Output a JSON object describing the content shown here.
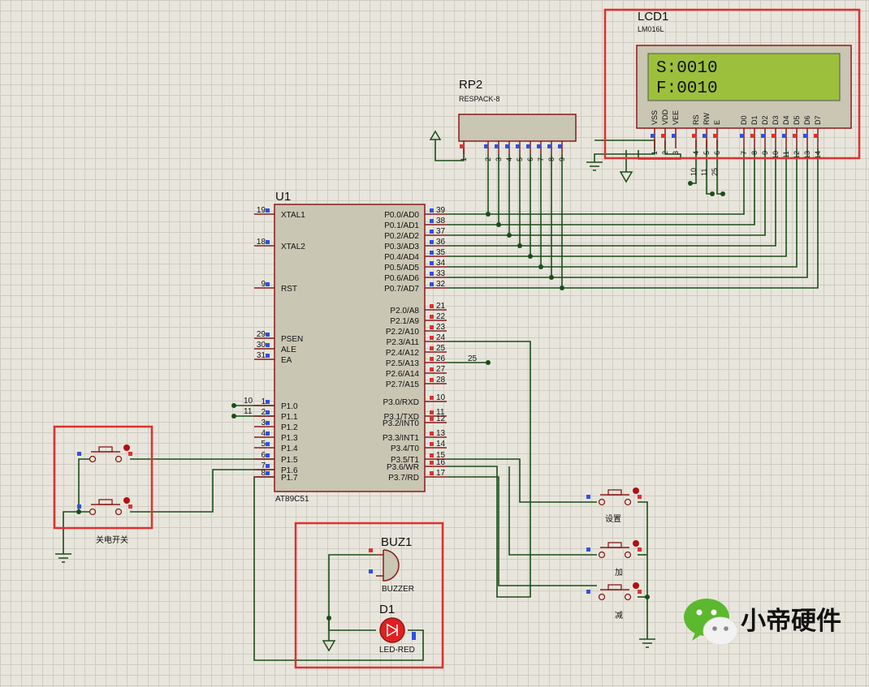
{
  "colors": {
    "background": "#e8e6dc",
    "grid": "#cfcdc2",
    "wire": "#1a4d1a",
    "component_border": "#8b1a1a",
    "component_fill": "#c9c6b4",
    "highlight": "#e03030",
    "lcd_screen": "#9cc03c",
    "led": "#e02020"
  },
  "lcd": {
    "ref": "LCD1",
    "part": "LM016L",
    "line1": "S:0010",
    "line2": "F:0010",
    "pin_names": [
      "VSS",
      "VDD",
      "VEE",
      "RS",
      "RW",
      "E",
      "D0",
      "D1",
      "D2",
      "D3",
      "D4",
      "D5",
      "D6",
      "D7"
    ],
    "pin_numbers": [
      "1",
      "2",
      "3",
      "4",
      "5",
      "6",
      "7",
      "8",
      "9",
      "10",
      "11",
      "12",
      "13",
      "14"
    ]
  },
  "rp2": {
    "ref": "RP2",
    "part": "RESPACK-8",
    "pin_numbers": [
      "1",
      "2",
      "3",
      "4",
      "5",
      "6",
      "7",
      "8",
      "9"
    ]
  },
  "mcu": {
    "ref": "U1",
    "part": "AT89C51",
    "left_pins": [
      {
        "num": "19",
        "name": "XTAL1"
      },
      {
        "num": "18",
        "name": "XTAL2"
      },
      {
        "num": "9",
        "name": "RST"
      },
      {
        "num": "29",
        "name": "PSEN"
      },
      {
        "num": "30",
        "name": "ALE"
      },
      {
        "num": "31",
        "name": "EA"
      },
      {
        "num": "1",
        "name": "P1.0"
      },
      {
        "num": "2",
        "name": "P1.1"
      },
      {
        "num": "3",
        "name": "P1.2"
      },
      {
        "num": "4",
        "name": "P1.3"
      },
      {
        "num": "5",
        "name": "P1.4"
      },
      {
        "num": "6",
        "name": "P1.5"
      },
      {
        "num": "7",
        "name": "P1.6"
      },
      {
        "num": "8",
        "name": "P1.7"
      }
    ],
    "right_pins": [
      {
        "num": "39",
        "name": "P0.0/AD0"
      },
      {
        "num": "38",
        "name": "P0.1/AD1"
      },
      {
        "num": "37",
        "name": "P0.2/AD2"
      },
      {
        "num": "36",
        "name": "P0.3/AD3"
      },
      {
        "num": "35",
        "name": "P0.4/AD4"
      },
      {
        "num": "34",
        "name": "P0.5/AD5"
      },
      {
        "num": "33",
        "name": "P0.6/AD6"
      },
      {
        "num": "32",
        "name": "P0.7/AD7"
      },
      {
        "num": "21",
        "name": "P2.0/A8"
      },
      {
        "num": "22",
        "name": "P2.1/A9"
      },
      {
        "num": "23",
        "name": "P2.2/A10"
      },
      {
        "num": "24",
        "name": "P2.3/A11"
      },
      {
        "num": "25",
        "name": "P2.4/A12"
      },
      {
        "num": "26",
        "name": "P2.5/A13"
      },
      {
        "num": "27",
        "name": "P2.6/A14"
      },
      {
        "num": "28",
        "name": "P2.7/A15"
      },
      {
        "num": "10",
        "name": "P3.0/RXD"
      },
      {
        "num": "11",
        "name": "P3.1/TXD"
      },
      {
        "num": "12",
        "name": "P3.2/INT0"
      },
      {
        "num": "13",
        "name": "P3.3/INT1"
      },
      {
        "num": "14",
        "name": "P3.4/T0"
      },
      {
        "num": "15",
        "name": "P3.5/T1"
      },
      {
        "num": "16",
        "name": "P3.6/WR"
      },
      {
        "num": "17",
        "name": "P3.7/RD"
      }
    ]
  },
  "net_labels": {
    "lcd_10": "10",
    "lcd_11": "11",
    "lcd_25": "25",
    "p25": "25",
    "p10": "10",
    "p11": "11"
  },
  "buttons": {
    "power_label": "关电开关",
    "set_label": "设置",
    "add_label": "加",
    "sub_label": "减"
  },
  "buzzer": {
    "ref": "BUZ1",
    "part": "BUZZER"
  },
  "led": {
    "ref": "D1",
    "part": "LED-RED"
  },
  "watermark": {
    "text": "小帝硬件",
    "icon": "wechat-icon"
  }
}
